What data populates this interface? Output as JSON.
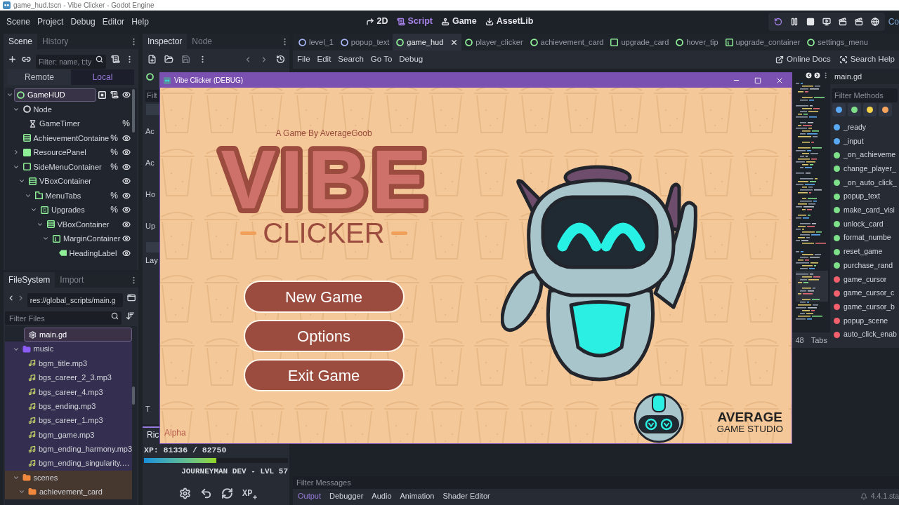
{
  "window": {
    "title": "game_hud.tscn - Vibe Clicker - Godot Engine"
  },
  "menu": [
    "Scene",
    "Project",
    "Debug",
    "Editor",
    "Help"
  ],
  "workspaces": [
    {
      "label": "2D",
      "kind": "canvas",
      "selected": false
    },
    {
      "label": "Script",
      "kind": "script",
      "selected": true
    },
    {
      "label": "Game",
      "kind": "game",
      "selected": false
    },
    {
      "label": "AssetLib",
      "kind": "assetlib",
      "selected": false
    }
  ],
  "run_bar": {
    "buttons": [
      {
        "kind": "restart",
        "active": true
      },
      {
        "kind": "pause",
        "active": false
      },
      {
        "kind": "stop",
        "active": false
      },
      {
        "kind": "remote",
        "active": false
      },
      {
        "kind": "movie",
        "active": false
      },
      {
        "kind": "movie",
        "active": false
      },
      {
        "kind": "debug",
        "active": false
      }
    ],
    "renderer": "Co"
  },
  "scene_dock": {
    "tabs": [
      {
        "label": "Scene",
        "selected": true
      },
      {
        "label": "History",
        "selected": false
      }
    ],
    "filter": {
      "placeholder": "Filter: name, t:ty"
    },
    "modes": [
      {
        "label": "Remote",
        "selected": false
      },
      {
        "label": "Local",
        "selected": true
      }
    ],
    "tree": [
      {
        "name": "GameHUD",
        "kind": "control",
        "selected": true,
        "expanded": true,
        "grouped": true,
        "script": true,
        "eye": true,
        "children": [
          {
            "name": "Node",
            "kind": "node",
            "selected": false,
            "expanded": true,
            "eye": false,
            "children": [
              {
                "name": "GameTimer",
                "kind": "timer",
                "selected": false,
                "badge": "%",
                "eye": false
              }
            ]
          },
          {
            "name": "AchievementContaine",
            "kind": "vbox",
            "selected": false,
            "badge": "%",
            "eye": true
          },
          {
            "name": "ResourcePanel",
            "kind": "panel",
            "selected": false,
            "expanded": false,
            "badge": "%",
            "eye": true
          },
          {
            "name": "SideMenuContainer",
            "kind": "container",
            "selected": false,
            "expanded": true,
            "badge": "%",
            "eye": true,
            "children": [
              {
                "name": "VBoxContainer",
                "kind": "vbox",
                "selected": false,
                "expanded": true,
                "eye": true,
                "children": [
                  {
                    "name": "MenuTabs",
                    "kind": "tabs",
                    "selected": false,
                    "expanded": true,
                    "badge": "%",
                    "eye": true,
                    "children": [
                      {
                        "name": "Upgrades",
                        "kind": "tab",
                        "selected": false,
                        "expanded": true,
                        "badge": "%",
                        "eye": true,
                        "children": [
                          {
                            "name": "VBoxContainer",
                            "kind": "vbox",
                            "selected": false,
                            "expanded": true,
                            "eye": true,
                            "children": [
                              {
                                "name": "MarginContainer",
                                "kind": "margin",
                                "selected": false,
                                "expanded": true,
                                "eye": true,
                                "children": [
                                  {
                                    "name": "HeadingLabel",
                                    "kind": "label",
                                    "selected": false,
                                    "eye": true
                                  }
                                ]
                              }
                            ]
                          }
                        ]
                      }
                    ]
                  }
                ]
              }
            ]
          }
        ]
      }
    ]
  },
  "filesystem_dock": {
    "tabs": [
      {
        "label": "FileSystem",
        "selected": true
      },
      {
        "label": "Import",
        "selected": false
      }
    ],
    "path": "res://global_scripts/main.g",
    "filter": {
      "placeholder": "Filter Files"
    },
    "tree": [
      {
        "children": [
          {
            "name": "main.gd",
            "kind": "script",
            "selected": true
          }
        ]
      },
      {
        "name": "music",
        "kind": "folder",
        "color": "#8b5cf6",
        "selected": false,
        "expanded": true,
        "children": [
          {
            "name": "bgm_title.mp3",
            "kind": "audio",
            "selected": false
          },
          {
            "name": "bgs_career_2_3.mp3",
            "kind": "audio",
            "selected": false
          },
          {
            "name": "bgs_career_4.mp3",
            "kind": "audio",
            "selected": false
          },
          {
            "name": "bgs_ending.mp3",
            "kind": "audio",
            "selected": false
          },
          {
            "name": "bgs_career_1.mp3",
            "kind": "audio",
            "selected": false
          },
          {
            "name": "bgm_game.mp3",
            "kind": "audio",
            "selected": false
          },
          {
            "name": "bgm_ending_harmony.mp3",
            "kind": "audio",
            "selected": false
          },
          {
            "name": "bgm_ending_singularity.…",
            "kind": "audio",
            "selected": false
          }
        ]
      },
      {
        "name": "scenes",
        "kind": "folder",
        "color": "#f0883e",
        "selected": false,
        "expanded": true,
        "children": [
          {
            "name": "achievement_card",
            "kind": "folder",
            "color": "#f0883e",
            "selected": false,
            "expanded": true
          }
        ]
      }
    ]
  },
  "inspector_dock": {
    "tabs": [
      {
        "label": "Inspector",
        "selected": true
      },
      {
        "label": "Node",
        "selected": false
      }
    ],
    "edited_node": {
      "kind": "control"
    },
    "filter": {
      "placeholder": "Filt"
    },
    "properties": [
      "Ac",
      "Ac",
      "Ho",
      "Up"
    ],
    "section": "Lay",
    "footer": "T"
  },
  "xp_dock": {
    "tabs": [
      {
        "label": "Ric",
        "selected": true
      }
    ],
    "xp": "XP: 81336 / 82750",
    "level": 0.5,
    "rank": "JOURNEYMAN DEV - LVL 57",
    "actions": [
      {
        "kind": "settings"
      },
      {
        "kind": "undo"
      },
      {
        "kind": "refresh"
      },
      {
        "kind": "xp",
        "label": "XP"
      }
    ]
  },
  "script_editor": {
    "tabs": [
      {
        "label": "level_1",
        "kind": "node2d",
        "selected": false
      },
      {
        "label": "popup_text",
        "kind": "node2d",
        "selected": false
      },
      {
        "label": "game_hud",
        "kind": "control",
        "selected": true
      },
      {
        "label": "player_clicker",
        "kind": "control",
        "selected": false
      },
      {
        "label": "achievement_card",
        "kind": "control",
        "selected": false
      },
      {
        "label": "upgrade_card",
        "kind": "container",
        "selected": false
      },
      {
        "label": "hover_tip",
        "kind": "control",
        "selected": false
      },
      {
        "label": "upgrade_container",
        "kind": "margin",
        "selected": false
      },
      {
        "label": "settings_menu",
        "kind": "control",
        "selected": false
      }
    ],
    "menu": [
      "File",
      "Edit",
      "Search",
      "Go To",
      "Debug"
    ],
    "help": [
      {
        "kind": "docs",
        "label": "Online Docs"
      },
      {
        "kind": "search",
        "label": "Search Help"
      }
    ],
    "status": {
      "line": "48",
      "indent": "Tabs"
    },
    "methods": {
      "file": "main.gd",
      "filter": {
        "placeholder": "Filter Methods"
      },
      "color_filters": [
        {
          "color": "#5aa9f5"
        },
        {
          "color": "#7fe08a"
        },
        {
          "color": "#f5d44a"
        },
        {
          "color": "#f5a35e"
        }
      ],
      "items": [
        {
          "name": "_ready",
          "color": "#5aa9f5"
        },
        {
          "name": "_input",
          "color": "#5aa9f5"
        },
        {
          "name": "_on_achieveme",
          "color": "#7fe08a"
        },
        {
          "name": "change_player_",
          "color": "#7fe08a"
        },
        {
          "name": "_on_auto_click_",
          "color": "#7fe08a"
        },
        {
          "name": "popup_text",
          "color": "#7fe08a"
        },
        {
          "name": "make_card_visi",
          "color": "#7fe08a"
        },
        {
          "name": "unlock_card",
          "color": "#7fe08a"
        },
        {
          "name": "format_numbe",
          "color": "#7fe08a"
        },
        {
          "name": "reset_game",
          "color": "#7fe08a"
        },
        {
          "name": "purchase_rand",
          "color": "#7fe08a"
        },
        {
          "name": "game_cursor",
          "color": "#f2606e"
        },
        {
          "name": "game_cursor_c",
          "color": "#f2606e"
        },
        {
          "name": "game_cursor_b",
          "color": "#f2606e"
        },
        {
          "name": "popup_scene",
          "color": "#f2606e"
        },
        {
          "name": "auto_click_enab",
          "color": "#f2606e"
        }
      ]
    }
  },
  "output": {
    "filter": {
      "placeholder": "Filter Messages"
    },
    "tabs": [
      {
        "label": "Output",
        "selected": true
      },
      {
        "label": "Debugger",
        "selected": false
      },
      {
        "label": "Audio",
        "selected": false
      },
      {
        "label": "Animation",
        "selected": false
      },
      {
        "label": "Shader Editor",
        "selected": false
      }
    ],
    "version": "4.4.1.sta"
  },
  "game_window": {
    "title": "Vibe Clicker (DEBUG)",
    "byline": "A Game By AverageGoob",
    "logo": {
      "title": "VIBE",
      "subtitle": "CLICKER"
    },
    "menu": [
      "New Game",
      "Options",
      "Exit Game"
    ],
    "build": "Alpha",
    "studio": {
      "name": "AVERAGE",
      "tagline": "GAME STUDIO"
    }
  }
}
